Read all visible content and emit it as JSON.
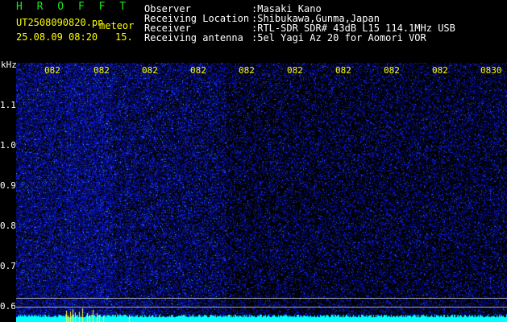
{
  "header": {
    "app_title": "H R O F F T",
    "file_name": "UT2508090820.pn",
    "file_suffix": "meteor",
    "date_time": "25.08.09 08:20",
    "step": "15.",
    "rows": [
      {
        "label": "Observer",
        "value": ":Masaki Kano"
      },
      {
        "label": "Receiving Location",
        "value": ":Shibukawa,Gunma,Japan"
      },
      {
        "label": "Receiver",
        "value": ":RTL-SDR SDR# 43dB L15 114.1MHz USB"
      },
      {
        "label": "Receiving antenna",
        "value": ":5el Yagi Az 20 for Aomori VOR"
      }
    ]
  },
  "axis": {
    "unit": "kHz",
    "y_ticks": [
      "1.1",
      "1.0",
      "0.9",
      "0.8",
      "0.7",
      "0.6"
    ],
    "x_ticks": [
      "082",
      "082",
      "082",
      "082",
      "082",
      "082",
      "082",
      "082",
      "082",
      "0830"
    ]
  },
  "colors": {
    "background": "#000000",
    "title_green": "#19e619",
    "label_yellow": "#ffff00",
    "noise_blue": "#1a2aff",
    "baseline_cyan": "#00ffff",
    "ping_yellow": "#ffff40"
  }
}
